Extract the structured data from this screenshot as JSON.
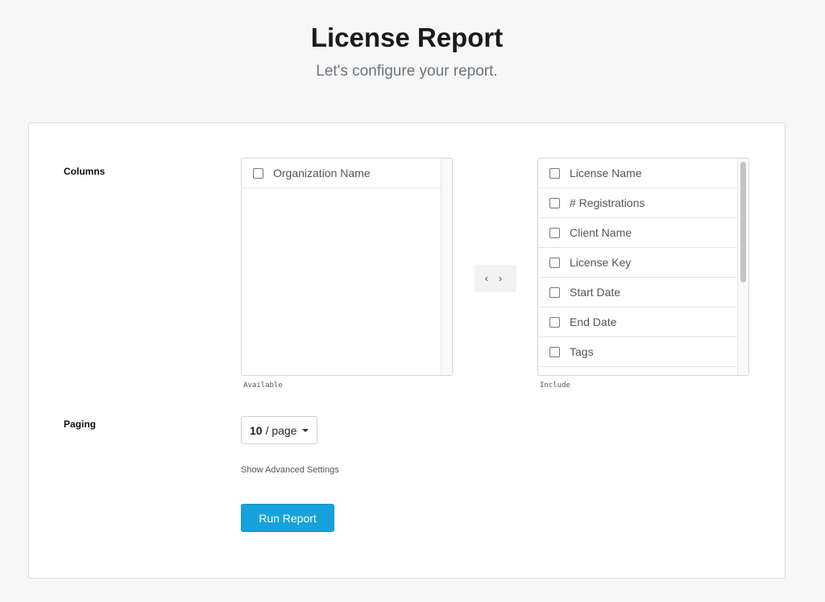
{
  "header": {
    "title": "License Report",
    "subtitle": "Let's configure your report."
  },
  "columns": {
    "label": "Columns",
    "available": {
      "caption": "Available",
      "items": [
        "Organization Name"
      ]
    },
    "transfer_icon": "chevron-left-right-icon",
    "transfer_glyph": "‹ ›",
    "include": {
      "caption": "Include",
      "items": [
        "License Name",
        "# Registrations",
        "Client Name",
        "License Key",
        "Start Date",
        "End Date",
        "Tags"
      ]
    }
  },
  "paging": {
    "label": "Paging",
    "selected_number": "10",
    "selected_suffix": "/ page"
  },
  "advanced_link": "Show Advanced Settings",
  "run_button": "Run Report",
  "colors": {
    "primary_button": "#17a2db",
    "background": "#f7f7f7"
  }
}
